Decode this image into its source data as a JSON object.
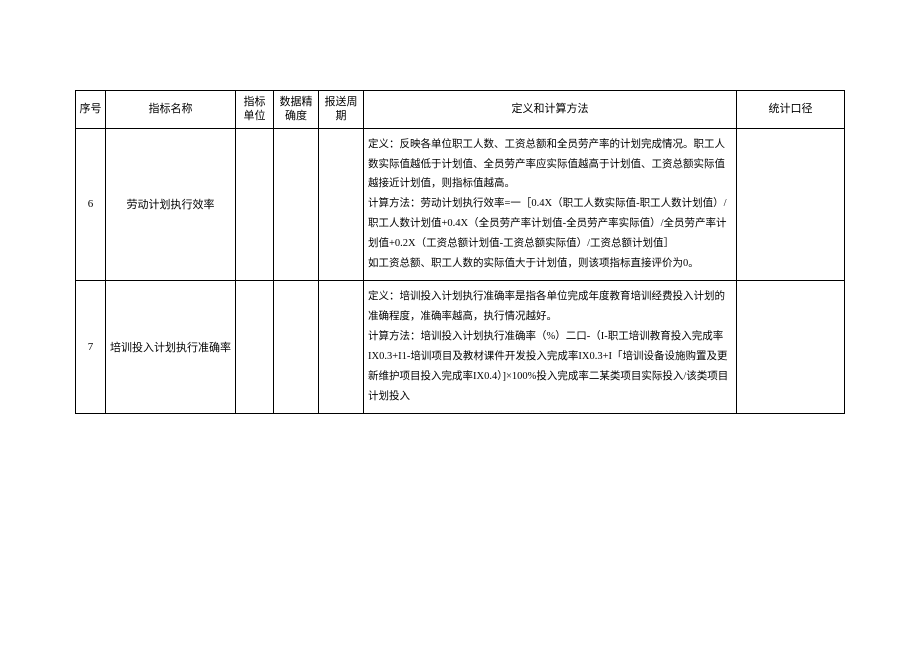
{
  "headers": {
    "seq": "序号",
    "name": "指标名称",
    "unit": "指标单位",
    "precision": "数据精确度",
    "cycle": "报送周期",
    "definition": "定义和计算方法",
    "stat": "统计口径"
  },
  "rows": [
    {
      "seq": "6",
      "name": "劳动计划执行效率",
      "unit": "",
      "precision": "",
      "cycle": "",
      "definition": "定义：反映各单位职工人数、工资总额和全员劳产率的计划完成情况。职工人数实际值越低于计划值、全员劳产率应实际值越高于计划值、工资总额实际值越接近计划值，则指标值越高。\n计算方法：劳动计划执行效率=一［0.4X（职工人数实际值-职工人数计划值）/职工人数计划值+0.4X（全员劳产率计划值-全员劳产率实际值）/全员劳产率计划值+0.2X（工资总额计划值-工资总额实际值）/工资总额计划值］\n如工资总额、职工人数的实际值大于计划值，则该项指标直接评价为0。",
      "stat": ""
    },
    {
      "seq": "7",
      "name": "培训投入计划执行准确率",
      "unit": "",
      "precision": "",
      "cycle": "",
      "definition": "定义：培训投入计划执行准确率是指各单位完成年度教育培训经费投入计划的准确程度，准确率越高，执行情况越好。\n计算方法：培训投入计划执行准确率（%）二口-（I-职工培训教育投入完成率IX0.3+I1-培训项目及教材课件开发投入完成率IX0.3+I「培训设备设施购置及更新维护项目投入完成率IX0.4）]×100%投入完成率二某类项目实际投入/该类项目计划投入",
      "stat": ""
    }
  ]
}
